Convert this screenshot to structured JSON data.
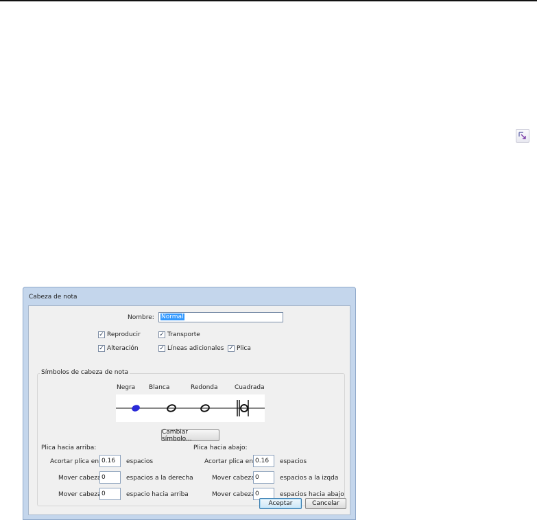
{
  "dialog": {
    "title": "Cabeza de nota",
    "name_label": "Nombre:",
    "name_value": "Normal",
    "checkboxes": {
      "reproducir": {
        "label": "Reproducir",
        "checked": true
      },
      "transporte": {
        "label": "Transporte",
        "checked": true
      },
      "alteracion": {
        "label": "Alteración",
        "checked": true
      },
      "lineas": {
        "label": "Líneas adicionales",
        "checked": true
      },
      "plica": {
        "label": "Plica",
        "checked": true
      }
    },
    "group_title": "Símbolos de cabeza de nota",
    "symbols": [
      "Negra",
      "Blanca",
      "Redonda",
      "Cuadrada"
    ],
    "change_symbol_button": "Cambiar símbolo...",
    "stem_up": {
      "title": "Plica hacia arriba:",
      "shorten_label": "Acortar plica en",
      "shorten_value": "0.16",
      "shorten_unit": "espacios",
      "move_right_label": "Mover cabeza",
      "move_right_value": "0",
      "move_right_unit": "espacios a la derecha",
      "move_up_label": "Mover cabeza",
      "move_up_value": "0",
      "move_up_unit": "espacio hacia arriba"
    },
    "stem_down": {
      "title": "Plica hacia abajo:",
      "shorten_label": "Acortar plica en",
      "shorten_value": "0.16",
      "shorten_unit": "espacios",
      "move_left_label": "Mover cabeza",
      "move_left_value": "0",
      "move_left_unit": "espacios a la izqda",
      "move_down_label": "Mover cabeza",
      "move_down_value": "0",
      "move_down_unit": "espacios hacia abajo"
    },
    "ok_button": "Aceptar",
    "cancel_button": "Cancelar"
  },
  "icons": {
    "corner": "dialog-launcher-icon",
    "selected_note_color": "#2a2ad8"
  }
}
